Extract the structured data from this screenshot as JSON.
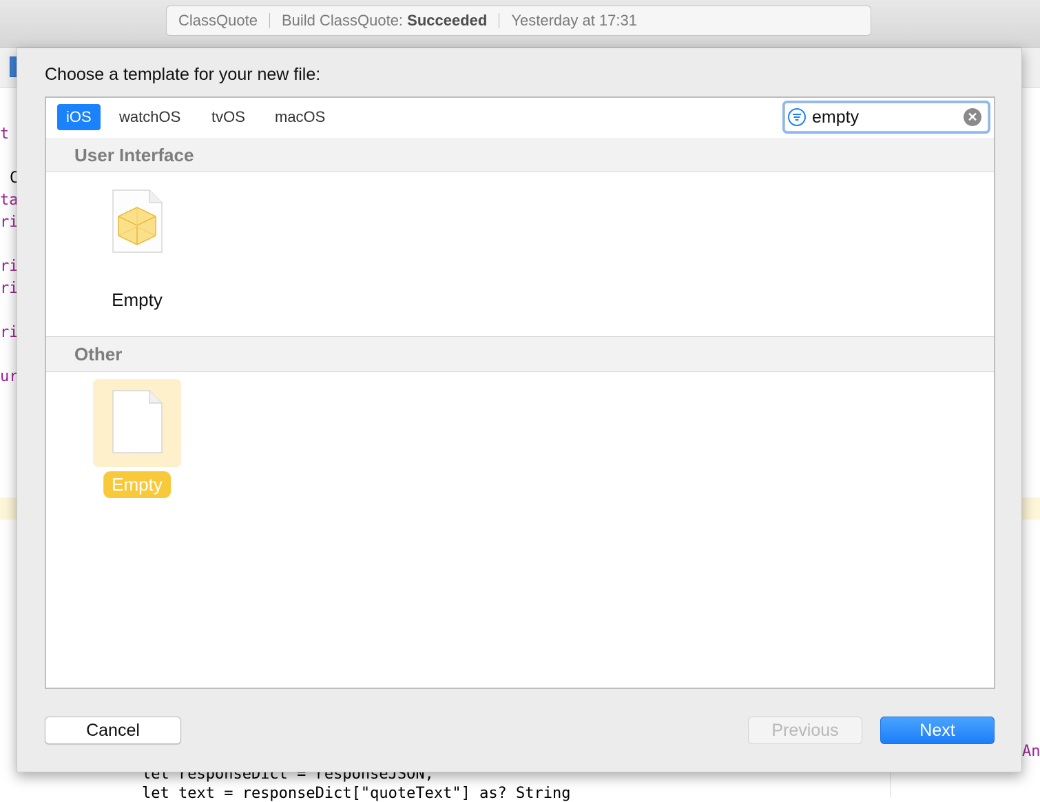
{
  "toolbar": {
    "project": "ClassQuote",
    "build_prefix": "Build ClassQuote: ",
    "build_status": "Succeeded",
    "timestamp": "Yesterday at 17:31"
  },
  "background_code": {
    "left_fragments": [
      "t",
      "C",
      "ta",
      "ri",
      "ri",
      "ri",
      "ri",
      "ur"
    ],
    "right_fragment": "An",
    "bottom_line_1": "let responseDict = responseJSON,",
    "bottom_line_2": "let text = responseDict[\"quoteText\"] as? String"
  },
  "dialog": {
    "title": "Choose a template for your new file:",
    "platform_tabs": [
      "iOS",
      "watchOS",
      "tvOS",
      "macOS"
    ],
    "active_tab": "iOS",
    "search": {
      "value": "empty"
    },
    "sections": [
      {
        "header": "User Interface",
        "items": [
          {
            "label": "Empty",
            "icon": "interface-builder-file-icon",
            "selected": false
          }
        ]
      },
      {
        "header": "Other",
        "items": [
          {
            "label": "Empty",
            "icon": "blank-file-icon",
            "selected": true
          }
        ]
      }
    ],
    "buttons": {
      "cancel": "Cancel",
      "previous": "Previous",
      "next": "Next"
    }
  },
  "colors": {
    "accent": "#1a82fb",
    "selection_bg": "#fdf0cb",
    "selection_label": "#f8c93a",
    "section_header_text": "#7d7d7d"
  }
}
